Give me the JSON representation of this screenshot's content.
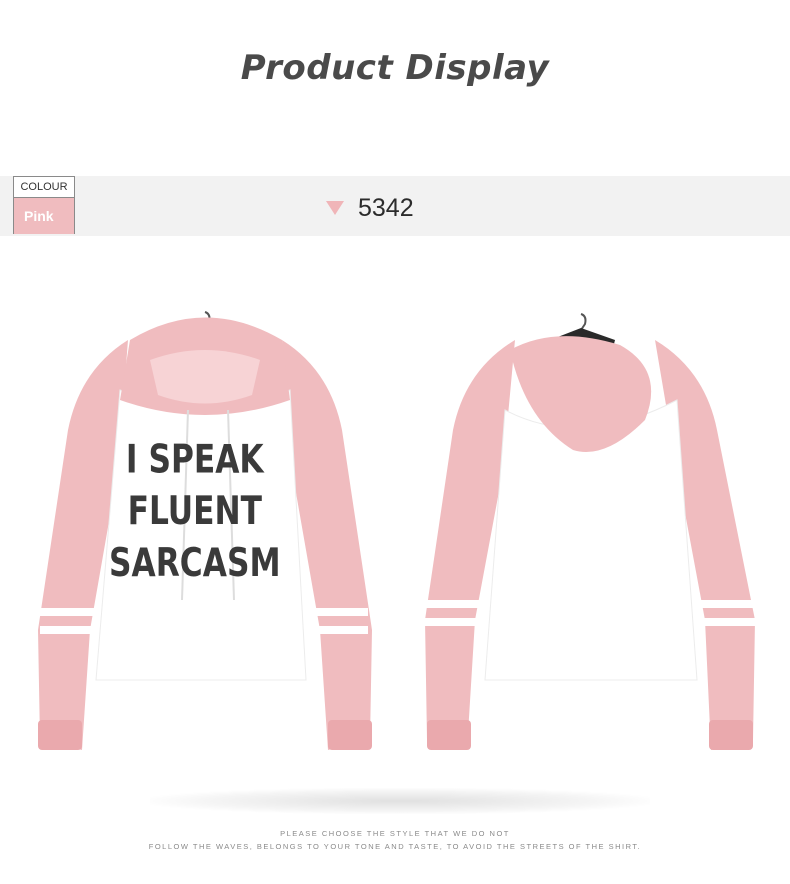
{
  "header": {
    "title": "Product Display"
  },
  "info_bar": {
    "colour_label": "COLOUR",
    "colour_value": "Pink",
    "code": "5342",
    "icon": "triangle-down-icon"
  },
  "product": {
    "front_print": [
      "I SPEAK",
      "FLUENT",
      "SARCASM"
    ]
  },
  "footer": {
    "line1": "PLEASE CHOOSE THE STYLE THAT WE DO NOT",
    "line2": "FOLLOW THE WAVES, BELONGS TO YOUR TONE AND TASTE, TO AVOID THE STREETS OF THE SHIRT."
  },
  "colors": {
    "pink": "#f0bcbf",
    "white": "#ffffff",
    "text": "#4a4a4a",
    "bar": "#f2f2f2"
  }
}
